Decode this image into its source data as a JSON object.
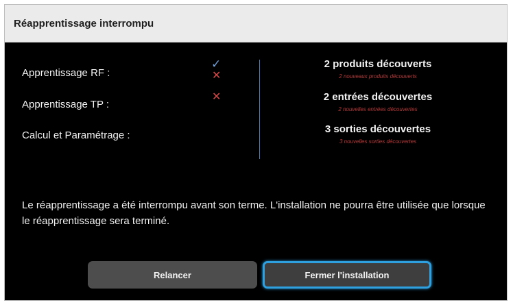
{
  "dialog": {
    "title": "Réapprentissage interrompu"
  },
  "steps": [
    {
      "label": "Apprentissage RF :",
      "status": [
        "check",
        "cross"
      ]
    },
    {
      "label": "Apprentissage TP :",
      "status": [
        "cross"
      ]
    },
    {
      "label": "Calcul et Paramétrage :",
      "status": []
    }
  ],
  "results": [
    {
      "main": "2 produits découverts",
      "sub": "2 nouveaux produits découverts"
    },
    {
      "main": "2 entrées découvertes",
      "sub": "2 nouvelles entrées découvertes"
    },
    {
      "main": "3 sorties découvertes",
      "sub": "3 nouvelles sorties découvertes"
    }
  ],
  "message": "Le réapprentissage a été interrompu avant son terme. L'installation ne pourra être utilisée que lorsque le réapprentissage sera terminé.",
  "buttons": {
    "relaunch": "Relancer",
    "close": "Fermer l'installation"
  },
  "icons": {
    "check": "✓",
    "cross": "✕"
  },
  "colors": {
    "check": "#6fa0d8",
    "cross": "#d64a4a",
    "focus": "#2ea0df",
    "sub_text": "#b83838"
  }
}
